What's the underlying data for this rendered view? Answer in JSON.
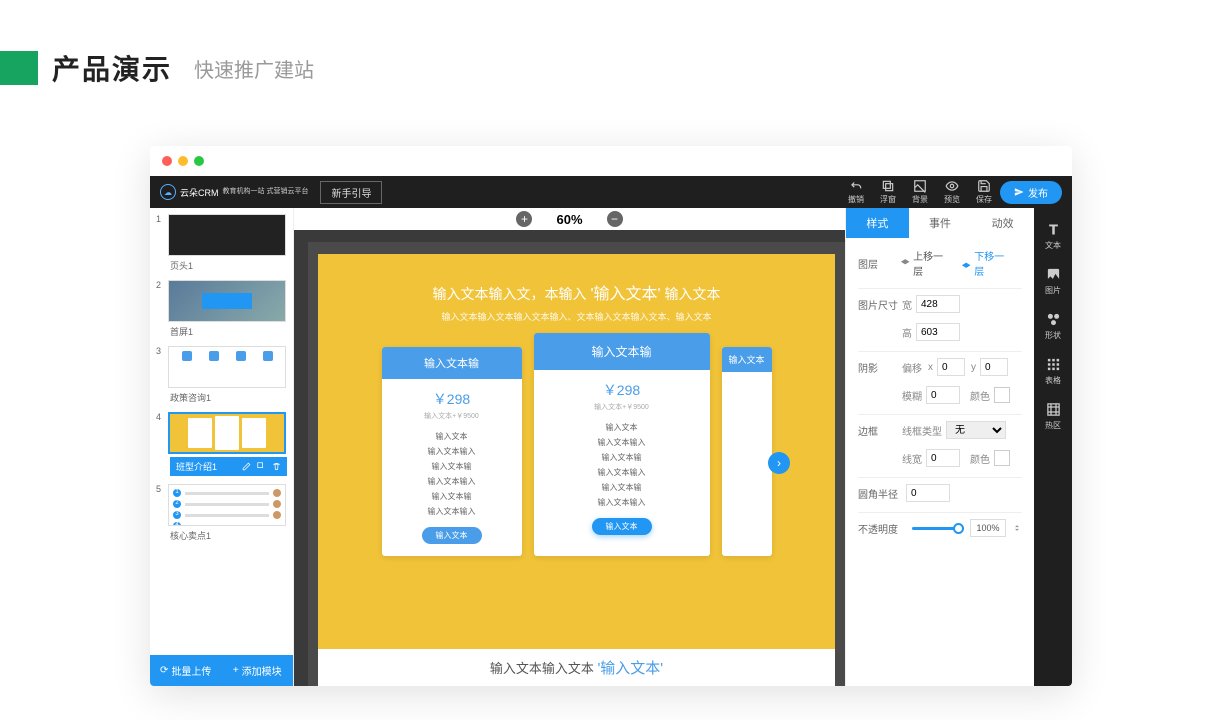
{
  "header": {
    "title": "产品演示",
    "subtitle": "快速推广建站"
  },
  "topbar": {
    "logo": "云朵CRM",
    "logo_sub": "教育机构一站\n式营销云平台",
    "guide": "新手引导",
    "icons": {
      "undo": "撤销",
      "float": "浮窗",
      "bg": "背景",
      "preview": "预览",
      "save": "保存"
    },
    "publish": "发布"
  },
  "zoom": {
    "value": "60%"
  },
  "thumbs": [
    {
      "num": "1",
      "label": "页头1"
    },
    {
      "num": "2",
      "label": "首屏1"
    },
    {
      "num": "3",
      "label": "政策咨询1"
    },
    {
      "num": "4",
      "label": "班型介绍1",
      "selected": true
    },
    {
      "num": "5",
      "label": "核心卖点1"
    }
  ],
  "left_actions": {
    "batch": "批量上传",
    "add": "添加模块"
  },
  "canvas": {
    "title_pre": "输入文本输入文，本输入 ",
    "title_hl": "'输入文本'",
    "title_post": " 输入文本",
    "subtitle": "输入文本输入文本输入文本输入、文本输入文本输入文本、输入文本",
    "cards": [
      {
        "head": "输入文本输",
        "price": "￥298",
        "price_sub": "输入文本+￥9500",
        "items": [
          "输入文本",
          "输入文本输入",
          "输入文本输",
          "输入文本输入",
          "输入文本输",
          "输入文本输入"
        ],
        "btn": "输入文本"
      },
      {
        "head": "输入文本输",
        "price": "￥298",
        "price_sub": "输入文本+￥9500",
        "items": [
          "输入文本",
          "输入文本输入",
          "输入文本输",
          "输入文本输入",
          "输入文本输",
          "输入文本输入"
        ],
        "btn": "输入文本"
      },
      {
        "head": "输入文本"
      }
    ],
    "bottom_pre": "输入文本输入文本 ",
    "bottom_hl": "'输入文本'"
  },
  "props": {
    "tabs": {
      "style": "样式",
      "event": "事件",
      "anim": "动效"
    },
    "layer": {
      "label": "图层",
      "up": "上移一层",
      "down": "下移一层"
    },
    "size": {
      "label": "图片尺寸",
      "w_lbl": "宽",
      "w": "428",
      "h_lbl": "高",
      "h": "603"
    },
    "shadow": {
      "label": "阴影",
      "offset": "偏移",
      "x_lbl": "x",
      "x": "0",
      "y_lbl": "y",
      "y": "0",
      "blur_lbl": "模糊",
      "blur": "0",
      "color_lbl": "颜色"
    },
    "border": {
      "label": "边框",
      "type_lbl": "线框类型",
      "type": "无",
      "width_lbl": "线宽",
      "width": "0",
      "color_lbl": "颜色"
    },
    "radius": {
      "label": "圆角半径",
      "val": "0"
    },
    "opacity": {
      "label": "不透明度",
      "val": "100%"
    }
  },
  "rail": [
    {
      "key": "text",
      "label": "文本"
    },
    {
      "key": "image",
      "label": "图片"
    },
    {
      "key": "shape",
      "label": "形状"
    },
    {
      "key": "table",
      "label": "表格"
    },
    {
      "key": "hotzone",
      "label": "热区"
    }
  ]
}
